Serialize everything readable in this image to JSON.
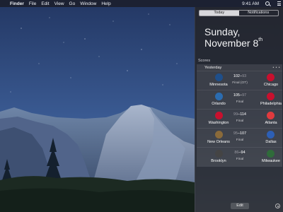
{
  "menubar": {
    "app_name": "Finder",
    "menus": [
      "File",
      "Edit",
      "View",
      "Go",
      "Window",
      "Help"
    ],
    "clock": "9:41 AM"
  },
  "notification_center": {
    "tabs": [
      "Today",
      "Notifications"
    ],
    "active_tab": "Today",
    "date_line1": "Sunday,",
    "date_line2": "November 8",
    "date_suffix": "th",
    "section_label": "Scores",
    "widget": {
      "header": "Yesterday",
      "more": "• • •",
      "games": [
        {
          "left": "Minnesota",
          "right": "Chicago",
          "score_left": "102",
          "score_right": "93",
          "sep": "–",
          "status": "Final (OT)",
          "winner": "left",
          "left_color": "#1f4f8a",
          "right_color": "#c8102e"
        },
        {
          "left": "Orlando",
          "right": "Philadelphia",
          "score_left": "105",
          "score_right": "97",
          "sep": "–",
          "status": "Final",
          "winner": "left",
          "left_color": "#2b6cb0",
          "right_color": "#c8102e"
        },
        {
          "left": "Washington",
          "right": "Atlanta",
          "score_left": "99",
          "score_right": "114",
          "sep": "–",
          "status": "Final",
          "winner": "right",
          "left_color": "#c8102e",
          "right_color": "#e03a3e"
        },
        {
          "left": "New Orleans",
          "right": "Dallas",
          "score_left": "95",
          "score_right": "107",
          "sep": "–",
          "status": "Final",
          "winner": "right",
          "left_color": "#8a6a3a",
          "right_color": "#2d5fb5"
        },
        {
          "left": "Brooklyn",
          "right": "Milwaukee",
          "score_left": "86",
          "score_right": "94",
          "sep": "–",
          "status": "Final",
          "winner": "right",
          "left_color": "#444444",
          "right_color": "#2f6b3a"
        }
      ]
    },
    "edit_label": "Edit"
  }
}
